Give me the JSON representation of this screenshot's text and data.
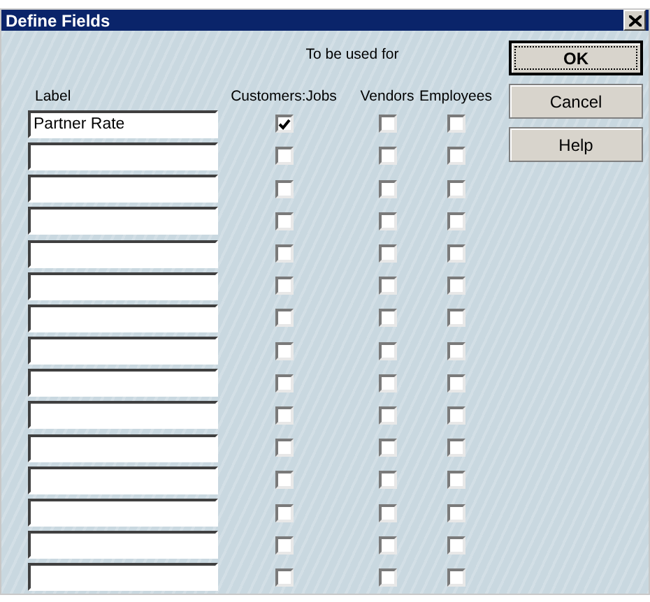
{
  "window": {
    "title": "Define Fields"
  },
  "header": {
    "group_label": "To be used for",
    "label_column": "Label",
    "columns": [
      "Customers:Jobs",
      "Vendors",
      "Employees"
    ]
  },
  "rows": [
    {
      "value": "Partner Rate",
      "checks": [
        true,
        false,
        false
      ]
    },
    {
      "checks": [
        false,
        false,
        false
      ]
    },
    {
      "checks": [
        false,
        false,
        false
      ]
    },
    {
      "checks": [
        false,
        false,
        false
      ]
    },
    {
      "checks": [
        false,
        false,
        false
      ]
    },
    {
      "checks": [
        false,
        false,
        false
      ]
    },
    {
      "checks": [
        false,
        false,
        false
      ]
    },
    {
      "checks": [
        false,
        false,
        false
      ]
    },
    {
      "checks": [
        false,
        false,
        false
      ]
    },
    {
      "checks": [
        false,
        false,
        false
      ]
    },
    {
      "checks": [
        false,
        false,
        false
      ]
    },
    {
      "checks": [
        false,
        false,
        false
      ]
    },
    {
      "checks": [
        false,
        false,
        false
      ]
    },
    {
      "checks": [
        false,
        false,
        false
      ]
    },
    {
      "checks": [
        false,
        false,
        false
      ]
    }
  ],
  "buttons": [
    {
      "label": "OK",
      "default": true
    },
    {
      "label": "Cancel",
      "default": false
    },
    {
      "label": "Help",
      "default": false
    }
  ]
}
